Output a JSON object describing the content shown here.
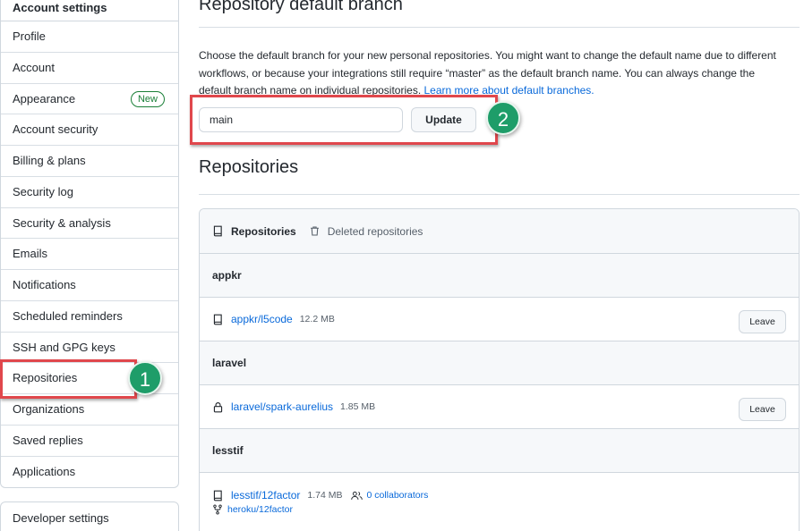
{
  "sidebar": {
    "header": "Account settings",
    "items": [
      {
        "label": "Profile"
      },
      {
        "label": "Account"
      },
      {
        "label": "Appearance",
        "badge": "New"
      },
      {
        "label": "Account security"
      },
      {
        "label": "Billing & plans"
      },
      {
        "label": "Security log"
      },
      {
        "label": "Security & analysis"
      },
      {
        "label": "Emails"
      },
      {
        "label": "Notifications"
      },
      {
        "label": "Scheduled reminders"
      },
      {
        "label": "SSH and GPG keys"
      },
      {
        "label": "Repositories"
      },
      {
        "label": "Organizations"
      },
      {
        "label": "Saved replies"
      },
      {
        "label": "Applications"
      }
    ],
    "developer": "Developer settings"
  },
  "branch": {
    "title": "Repository default branch",
    "description": "Choose the default branch for your new personal repositories. You might want to change the default name due to different workflows, or because your integrations still require “master” as the default branch name. You can always change the default branch name on individual repositories.",
    "learn_more": "Learn more about default branches.",
    "input_value": "main",
    "update_label": "Update"
  },
  "callouts": {
    "one": "1",
    "two": "2"
  },
  "repositories": {
    "title": "Repositories",
    "tab_active": "Repositories",
    "tab_deleted": "Deleted repositories",
    "leave_label": "Leave",
    "groups": [
      {
        "org": "appkr",
        "repo": "appkr/l5code",
        "size": "12.2 MB",
        "icon": "repo-icon"
      },
      {
        "org": "laravel",
        "repo": "laravel/spark-aurelius",
        "size": "1.85 MB",
        "icon": "lock-icon"
      },
      {
        "org": "lesstif",
        "repo": "lesstif/12factor",
        "size": "1.74 MB",
        "icon": "repo-icon",
        "collaborators": "0 collaborators",
        "fork": "heroku/12factor"
      }
    ]
  },
  "colors": {
    "accent_link": "#0969da",
    "callout_red": "#e0474c",
    "callout_green": "#1e9d69",
    "new_badge": "#1a7f37"
  }
}
